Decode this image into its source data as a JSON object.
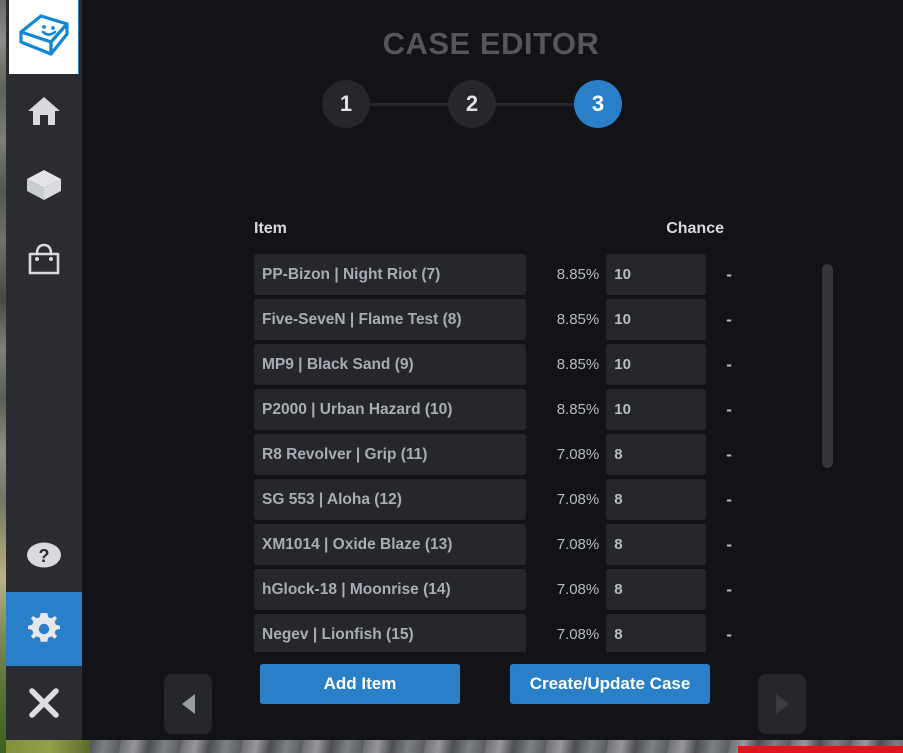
{
  "app": {
    "title": "CASE EDITOR",
    "accent_color": "#2a7fc9",
    "panel_color": "#121317",
    "field_color": "#26272c",
    "sidebar_color": "#2a2c31"
  },
  "sidebar": {
    "logo_name": "keycap-smiley-logo",
    "items": [
      {
        "name": "home-icon",
        "label": "Home",
        "active": false
      },
      {
        "name": "box-icon",
        "label": "Cases",
        "active": false
      },
      {
        "name": "bag-icon",
        "label": "Shop",
        "active": false
      },
      {
        "name": "help-icon",
        "label": "Help",
        "active": false
      },
      {
        "name": "gear-icon",
        "label": "Settings",
        "active": true
      },
      {
        "name": "close-icon",
        "label": "Close",
        "active": false
      }
    ]
  },
  "stepper": {
    "steps": [
      {
        "label": "1",
        "active": false
      },
      {
        "label": "2",
        "active": false
      },
      {
        "label": "3",
        "active": true
      }
    ]
  },
  "table": {
    "headers": {
      "item": "Item",
      "chance": "Chance"
    },
    "remove_label": "-",
    "rows": [
      {
        "item": "PP-Bizon | Night Riot (7)",
        "pct": "8.85%",
        "chance": "10"
      },
      {
        "item": "Five-SeveN | Flame Test (8)",
        "pct": "8.85%",
        "chance": "10"
      },
      {
        "item": "MP9 | Black Sand (9)",
        "pct": "8.85%",
        "chance": "10"
      },
      {
        "item": "P2000 | Urban Hazard (10)",
        "pct": "8.85%",
        "chance": "10"
      },
      {
        "item": "R8 Revolver | Grip (11)",
        "pct": "7.08%",
        "chance": "8"
      },
      {
        "item": "SG 553 | Aloha (12)",
        "pct": "7.08%",
        "chance": "8"
      },
      {
        "item": "XM1014 | Oxide Blaze (13)",
        "pct": "7.08%",
        "chance": "8"
      },
      {
        "item": "hGlock-18 | Moonrise (14)",
        "pct": "7.08%",
        "chance": "8"
      },
      {
        "item": "Negev | Lionfish (15)",
        "pct": "7.08%",
        "chance": "8"
      }
    ]
  },
  "actions": {
    "add_item": "Add Item",
    "create_update": "Create/Update Case"
  },
  "nav": {
    "prev_name": "prev-arrow-icon",
    "next_name": "next-arrow-icon"
  }
}
